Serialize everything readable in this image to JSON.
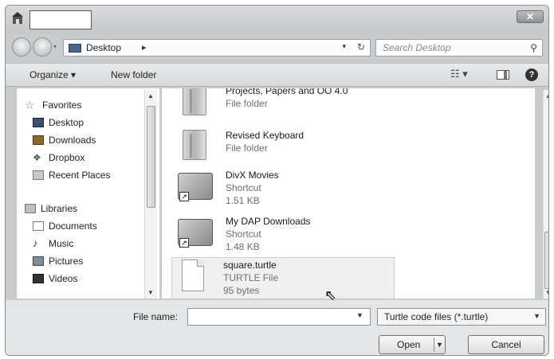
{
  "window": {
    "title_value": "",
    "close_label": "✕"
  },
  "address": {
    "location": "Desktop",
    "separator": "▸"
  },
  "search": {
    "placeholder": "Search Desktop"
  },
  "toolbar": {
    "organize_label": "Organize ▾",
    "new_folder_label": "New folder",
    "help_label": "?"
  },
  "navpane": {
    "favorites_label": "Favorites",
    "favorites": [
      "Desktop",
      "Downloads",
      "Dropbox",
      "Recent Places"
    ],
    "libraries_label": "Libraries",
    "libraries": [
      "Documents",
      "Music",
      "Pictures",
      "Videos"
    ]
  },
  "files": [
    {
      "name": "Projects, Papers and OO 4.0",
      "type": "File folder",
      "size": "",
      "icon": "folder-icon"
    },
    {
      "name": "Revised Keyboard",
      "type": "File folder",
      "size": "",
      "icon": "folder-icon"
    },
    {
      "name": "DivX Movies",
      "type": "Shortcut",
      "size": "1.51 KB",
      "icon": "shortcut-icon"
    },
    {
      "name": "My DAP Downloads",
      "type": "Shortcut",
      "size": "1.48 KB",
      "icon": "shortcut-icon"
    },
    {
      "name": "square.turtle",
      "type": "TURTLE File",
      "size": "95 bytes",
      "icon": "document-icon"
    }
  ],
  "bottom": {
    "file_name_label": "File name:",
    "file_name_value": "",
    "filter_value": "Turtle code files (*.turtle)",
    "open_label": "Open",
    "cancel_label": "Cancel"
  }
}
